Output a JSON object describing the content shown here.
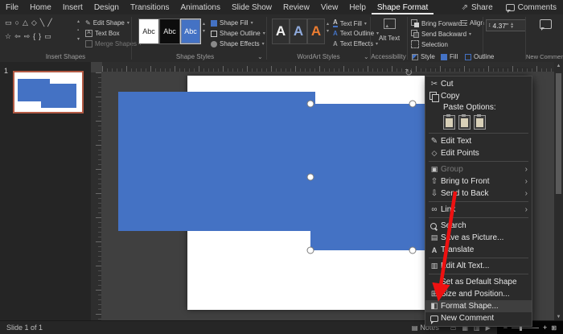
{
  "titlebar": {
    "menus": [
      {
        "label": "File"
      },
      {
        "label": "Home"
      },
      {
        "label": "Insert"
      },
      {
        "label": "Design"
      },
      {
        "label": "Transitions"
      },
      {
        "label": "Animations"
      },
      {
        "label": "Slide Show"
      },
      {
        "label": "Review"
      },
      {
        "label": "View"
      },
      {
        "label": "Help"
      },
      {
        "label": "Shape Format",
        "active": true
      }
    ],
    "share_label": "Share",
    "comments_label": "Comments"
  },
  "ribbon": {
    "insert_shapes": {
      "label": "Insert Shapes",
      "glyph_row1": "▭○△◇╲╱",
      "glyph_row2": "☆⇦⇨{}▭",
      "edit_shape": "Edit Shape",
      "text_box": "Text Box",
      "merge_shapes": "Merge Shapes"
    },
    "shape_styles": {
      "label": "Shape Styles",
      "preset_text": "Abc",
      "shape_fill": "Shape Fill",
      "shape_outline": "Shape Outline",
      "shape_effects": "Shape Effects"
    },
    "wordart": {
      "label": "WordArt Styles",
      "letter": "A",
      "text_fill": "Text Fill",
      "text_outline": "Text Outline",
      "text_effects": "Text Effects"
    },
    "accessibility": {
      "label": "Accessibility",
      "alt_text": "Alt Text"
    },
    "arrange": {
      "bring_forward": "Bring Forward",
      "send_backward": "Send Backward",
      "selection": "Selection",
      "align": "Align"
    },
    "size": {
      "height": "4.37\""
    },
    "quick": {
      "style": "Style",
      "fill": "Fill",
      "outline": "Outline"
    },
    "new_comment": "New Comment"
  },
  "thumbnails": {
    "slide_number": "1"
  },
  "context_menu": {
    "items": [
      {
        "label": "Cut",
        "icon": "cut"
      },
      {
        "label": "Copy",
        "icon": "copy"
      },
      {
        "type": "header",
        "label": "Paste Options:"
      },
      {
        "type": "paste-icons"
      },
      {
        "label": "Edit Text",
        "icon": "edit-text",
        "separator_before": true
      },
      {
        "label": "Edit Points",
        "icon": "edit-points"
      },
      {
        "label": "Group",
        "icon": "group",
        "submenu": true,
        "disabled": true,
        "separator_before": true
      },
      {
        "label": "Bring to Front",
        "icon": "bring-front",
        "submenu": true
      },
      {
        "label": "Send to Back",
        "icon": "send-back",
        "submenu": true
      },
      {
        "label": "Link",
        "icon": "link",
        "submenu": true,
        "separator_before": true
      },
      {
        "label": "Search",
        "icon": "search",
        "separator_before": true
      },
      {
        "label": "Save as Picture...",
        "icon": "save-picture"
      },
      {
        "label": "Translate",
        "icon": "translate"
      },
      {
        "label": "Edit Alt Text...",
        "icon": "alt-text",
        "separator_before": true
      },
      {
        "label": "Set as Default Shape",
        "separator_before": true
      },
      {
        "label": "Size and Position...",
        "icon": "size-position"
      },
      {
        "label": "Format Shape...",
        "icon": "format-shape",
        "highlighted": true
      },
      {
        "label": "New Comment",
        "icon": "new-comment"
      }
    ]
  },
  "status_bar": {
    "slide_indicator": "Slide 1 of 1",
    "notes_label": "Notes"
  },
  "colors": {
    "shape_blue": "#4472C4",
    "arrow_red": "#ee1111",
    "thumbnail_selection": "#b35a44"
  }
}
